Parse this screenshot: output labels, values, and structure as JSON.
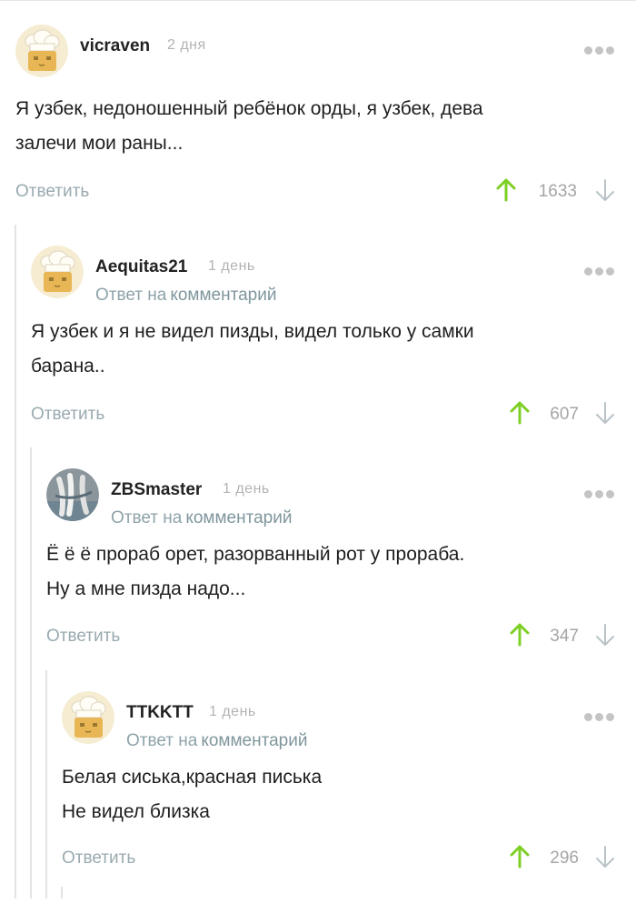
{
  "colors": {
    "upvote": "#7ecf24",
    "downvote": "#b9c3c8",
    "link": "#8ea3aa"
  },
  "comments": [
    {
      "username": "vicraven",
      "date": "2 дня",
      "avatar": "default-chef-avatar",
      "reply_to": null,
      "lines": [
        "Я узбек, недоношенный ребёнок орды, я узбек, дева",
        "залечи мои раны..."
      ],
      "reply_label": "Ответить",
      "rating": "1633"
    },
    {
      "username": "Aequitas21",
      "date": "1 день",
      "avatar": "default-chef-avatar",
      "reply_to": {
        "prefix": "Ответ на",
        "link": "комментарий"
      },
      "lines": [
        "Я узбек и я не видел пизды, видел только у самки",
        "барана.."
      ],
      "reply_label": "Ответить",
      "rating": "607"
    },
    {
      "username": "ZBSmaster",
      "date": "1 день",
      "avatar": "photo-avatar",
      "reply_to": {
        "prefix": "Ответ на",
        "link": "комментарий"
      },
      "lines": [
        "Ё ё ё прораб орет, разорванный рот у прораба.",
        "Ну а мне пизда надо..."
      ],
      "reply_label": "Ответить",
      "rating": "347"
    },
    {
      "username": "TTKKTT",
      "date": "1 день",
      "avatar": "default-chef-avatar",
      "reply_to": {
        "prefix": "Ответ на",
        "link": "комментарий"
      },
      "lines": [
        "Белая сиська,красная писька",
        "Не видел близка"
      ],
      "reply_label": "Ответить",
      "rating": "296"
    }
  ]
}
